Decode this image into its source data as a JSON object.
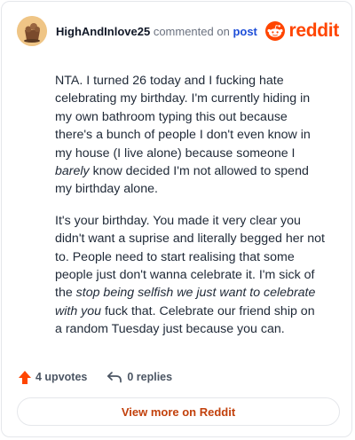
{
  "header": {
    "username": "HighAndInlove25",
    "action_text": "commented on",
    "post_link": "post",
    "brand_name": "reddit",
    "brand_color": "#ff4500"
  },
  "comment": {
    "p1_a": "NTA. I turned 26 today and I fucking hate celebrating my birthday. I'm currently hiding in my own bathroom typing this out because there's a bunch of people I don't even know in my house (I live alone) because someone I ",
    "p1_em": "barely",
    "p1_b": " know decided I'm not allowed to spend my birthday alone.",
    "p2_a": "It's your birthday. You made it very clear you didn't want a suprise and literally begged her not to. People need to start realising that some people just don't wanna celebrate it. I'm sick of the ",
    "p2_em": "stop being selfish we just want to celebrate with you",
    "p2_b": " fuck that. Celebrate our friend ship on a random Tuesday just because you can."
  },
  "footer": {
    "upvotes": "4 upvotes",
    "replies": "0 replies",
    "upvote_icon": "arrow-up-icon",
    "reply_icon": "reply-arrow-icon",
    "upvote_color": "#ff4500"
  },
  "cta": {
    "label": "View more on Reddit"
  }
}
